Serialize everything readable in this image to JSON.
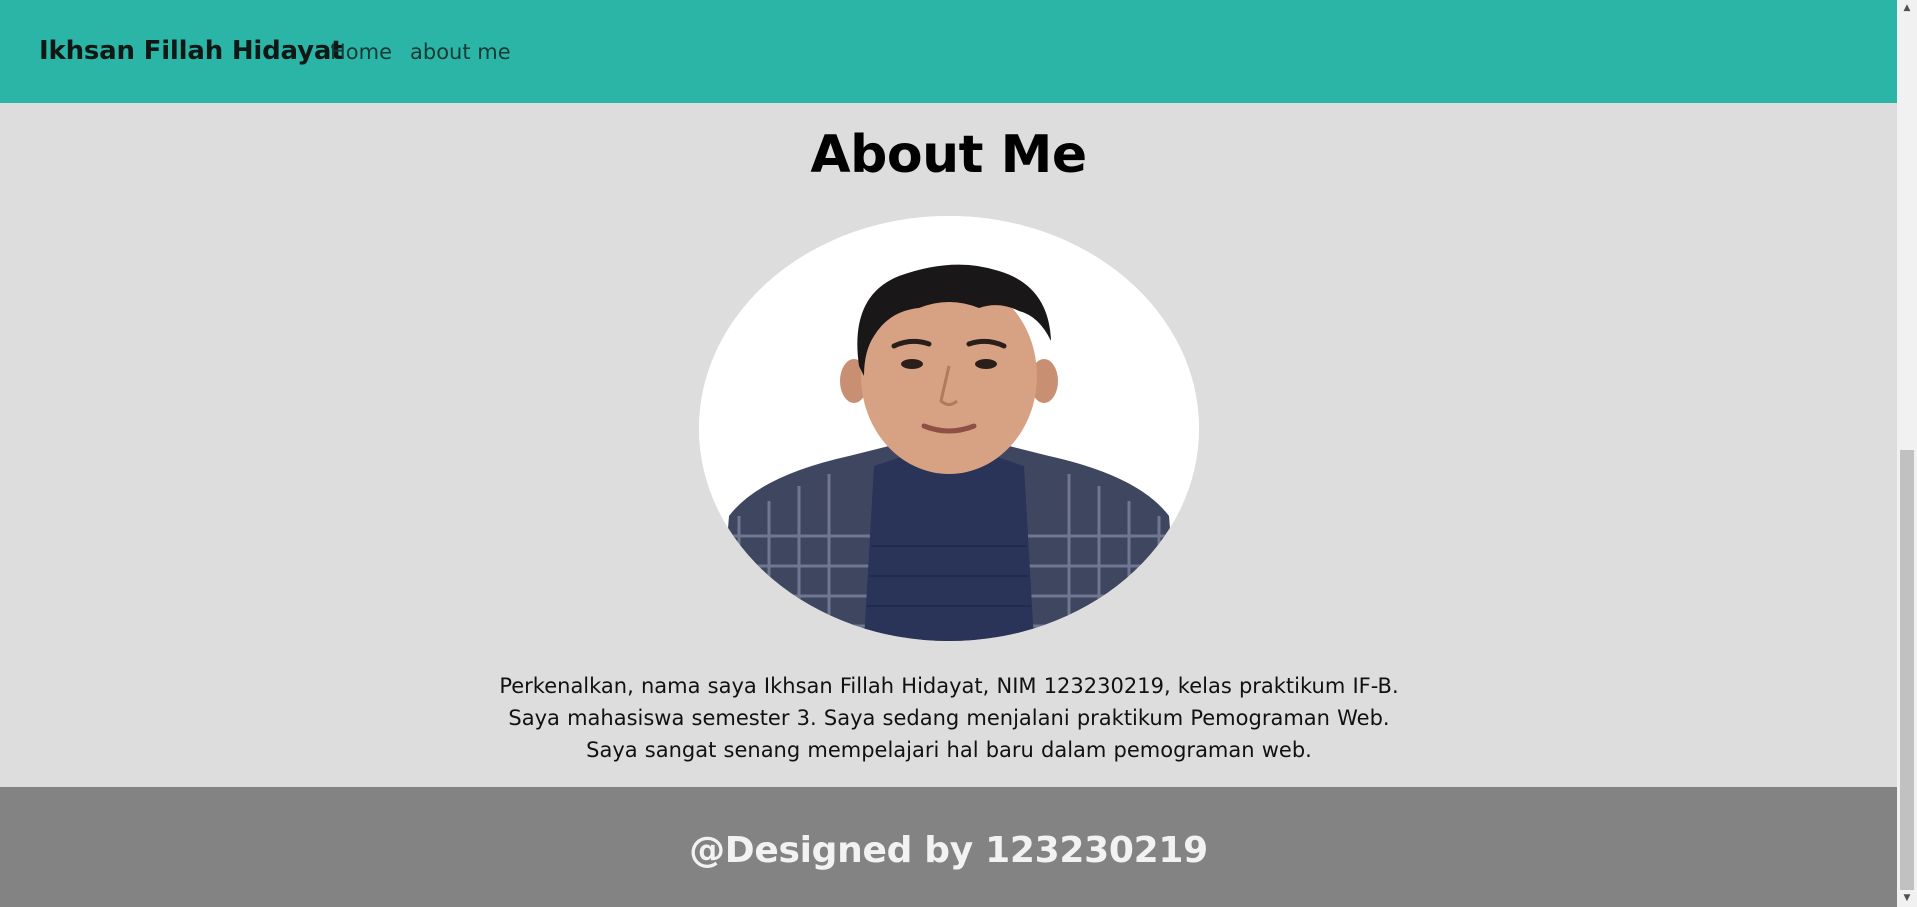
{
  "nav": {
    "brand": "Ikhsan Fillah Hidayat",
    "links": [
      {
        "label": "Home"
      },
      {
        "label": "about me"
      }
    ]
  },
  "main": {
    "title": "About Me",
    "photo_icon": "profile-photo",
    "bio": "Perkenalkan, nama saya Ikhsan Fillah Hidayat, NIM 123230219, kelas praktikum IF-B. Saya mahasiswa semester 3. Saya sedang menjalani praktikum Pemograman Web. Saya sangat senang mempelajari hal baru dalam pemograman web."
  },
  "footer": {
    "text": "@Designed by 123230219"
  },
  "colors": {
    "navbar": "#2bb5a7",
    "main_bg": "#dddddd",
    "footer_bg": "#838383",
    "footer_text": "#f2f2f2"
  },
  "scrollbar": {
    "up_icon": "scroll-up-arrow",
    "down_icon": "scroll-down-arrow"
  }
}
